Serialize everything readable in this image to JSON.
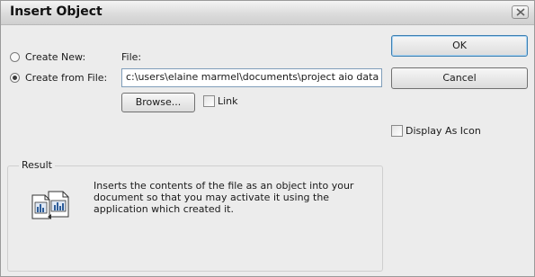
{
  "dialog": {
    "title": "Insert Object",
    "close_glyph": "✕"
  },
  "options": {
    "create_new": {
      "label": "Create New:",
      "checked": false
    },
    "create_from_file": {
      "label": "Create from File:",
      "checked": true
    }
  },
  "file": {
    "label": "File:",
    "value": "c:\\users\\elaine marmel\\documents\\project aio data file"
  },
  "buttons": {
    "browse": "Browse...",
    "ok": "OK",
    "cancel": "Cancel"
  },
  "checkboxes": {
    "link": {
      "label": "Link",
      "checked": false
    },
    "display_as_icon": {
      "label": "Display As Icon",
      "checked": false
    }
  },
  "result": {
    "legend": "Result",
    "text": "Inserts the contents of the file as an object into your document so that you may activate it using the application which created it.",
    "icon": "insert-file-object-icon"
  },
  "colors": {
    "dialog_bg": "#ececec",
    "textbox_border": "#7f9db9"
  }
}
